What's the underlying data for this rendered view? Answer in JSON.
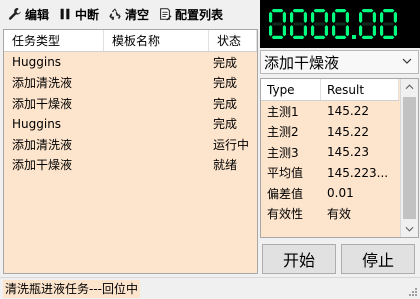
{
  "toolbar": {
    "items": [
      {
        "label": "编辑",
        "icon": "wrench-icon"
      },
      {
        "label": "中断",
        "icon": "pause-icon"
      },
      {
        "label": "清空",
        "icon": "recycle-icon"
      },
      {
        "label": "配置列表",
        "icon": "list-edit-icon"
      }
    ]
  },
  "display": {
    "value": "0000.00",
    "color": "#00ff7f"
  },
  "tasks": {
    "headers": [
      "任务类型",
      "模板名称",
      "状态"
    ],
    "rows": [
      {
        "type": "Huggins",
        "template": "",
        "status": "完成"
      },
      {
        "type": "添加清洗液",
        "template": "",
        "status": "完成"
      },
      {
        "type": "添加干燥液",
        "template": "",
        "status": "完成"
      },
      {
        "type": "Huggins",
        "template": "",
        "status": "完成"
      },
      {
        "type": "添加清洗液",
        "template": "",
        "status": "运行中"
      },
      {
        "type": "添加干燥液",
        "template": "",
        "status": "就绪"
      }
    ]
  },
  "select": {
    "value": "添加干燥液"
  },
  "results": {
    "headers": [
      "Type",
      "Result"
    ],
    "rows": [
      {
        "type": "主测1",
        "result": "145.22"
      },
      {
        "type": "主测2",
        "result": "145.22"
      },
      {
        "type": "主测3",
        "result": "145.23"
      },
      {
        "type": "平均值",
        "result": "145.223..."
      },
      {
        "type": "偏差值",
        "result": "0.01"
      },
      {
        "type": "有效性",
        "result": "有效"
      }
    ]
  },
  "buttons": {
    "start": "开始",
    "stop": "停止"
  },
  "status": {
    "text": "清洗瓶进液任务---回位中"
  },
  "colors": {
    "panel_bg": "#fde4cc",
    "display_bg": "#000000"
  }
}
